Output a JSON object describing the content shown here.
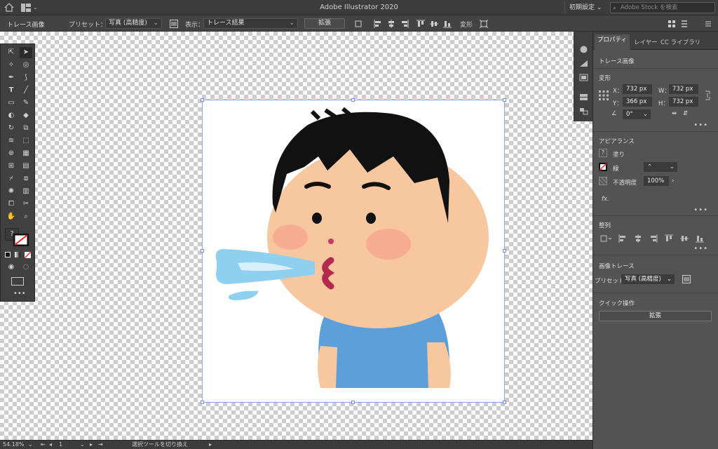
{
  "titlebar": {
    "title": "Adobe Illustrator 2020",
    "workspace": "初期設定",
    "search_placeholder": "Adobe Stock を検索"
  },
  "controlbar": {
    "context": "トレース画像",
    "preset_label": "プリセット：",
    "preset_value": "写真 (高精度)",
    "view_label": "表示：",
    "view_value": "トレース結果",
    "expand": "拡張",
    "transform": "変形"
  },
  "props": {
    "tabs": [
      "プロパティ",
      "レイヤー",
      "CC ライブラリ"
    ],
    "title": "トレース画像",
    "transform": {
      "heading": "変形",
      "x_label": "X：",
      "x": "732 px",
      "y_label": "Y：",
      "y": "366 px",
      "w_label": "W：",
      "w": "732 px",
      "h_label": "H：",
      "h": "732 px",
      "angle": "0°"
    },
    "appearance": {
      "heading": "アピアランス",
      "fill": "塗り",
      "stroke": "線",
      "opacity_label": "不透明度",
      "opacity": "100%",
      "fx": "fx."
    },
    "align": {
      "heading": "整列"
    },
    "trace": {
      "heading": "画像トレース",
      "preset_label": "プリセット：",
      "preset": "写真 (高精度)"
    },
    "quick": {
      "heading": "クイック操作",
      "expand": "拡張"
    }
  },
  "status": {
    "zoom": "54.18%",
    "page": "1",
    "tool": "選択ツールを切り換え"
  },
  "colors": {
    "accent": "#8aa6f0",
    "hair": "#111111",
    "skin": "#f7c8a0",
    "shirt": "#5d9fd8",
    "water": "#8fd0f0"
  }
}
